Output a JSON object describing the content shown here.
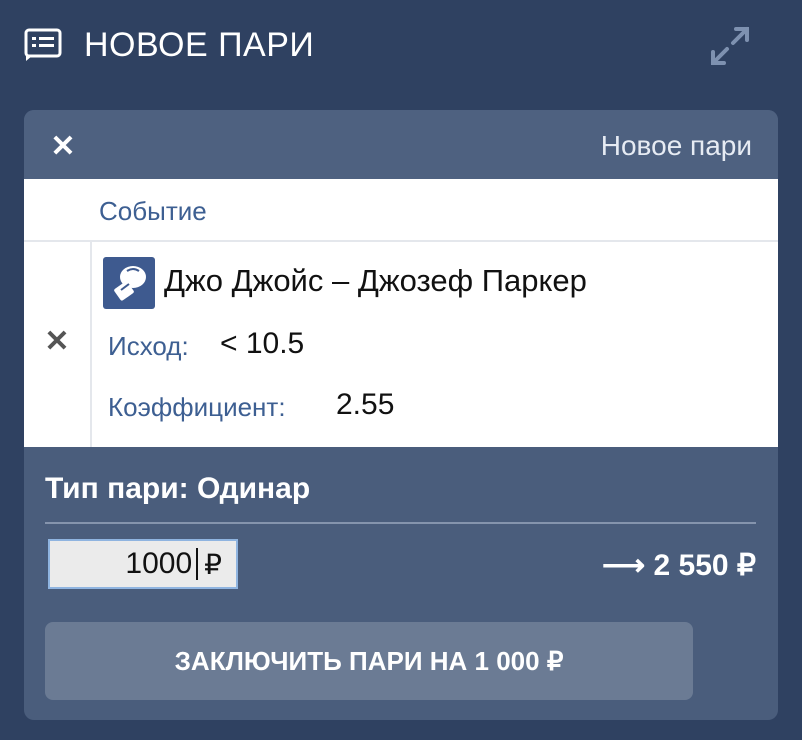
{
  "header": {
    "title": "НОВОЕ ПАРИ",
    "icon": "receipt-list-icon",
    "expand_icon": "expand-arrows-icon"
  },
  "card": {
    "header_label": "Новое пари",
    "close_icon": "close-icon"
  },
  "table": {
    "column_header": "Событие",
    "row": {
      "sport_icon": "boxing-glove-icon",
      "event": "Джо Джойс – Джозеф Паркер",
      "outcome_label": "Исход:",
      "outcome_value": "< 10.5",
      "odds_label": "Коэффициент:",
      "odds_value": "2.55",
      "remove_icon": "remove-x-icon"
    }
  },
  "bet": {
    "type": "Тип пари: Одинар",
    "stake_value": "1000",
    "currency": "₽",
    "payout": "⟶ 2 550 ₽",
    "submit_label": "ЗАКЛЮЧИТЬ ПАРИ НА 1 000 ₽"
  },
  "colors": {
    "background": "#2f4161",
    "card": "#4a5d7c",
    "label_blue": "#3d5f92",
    "button": "#6b7b94"
  }
}
